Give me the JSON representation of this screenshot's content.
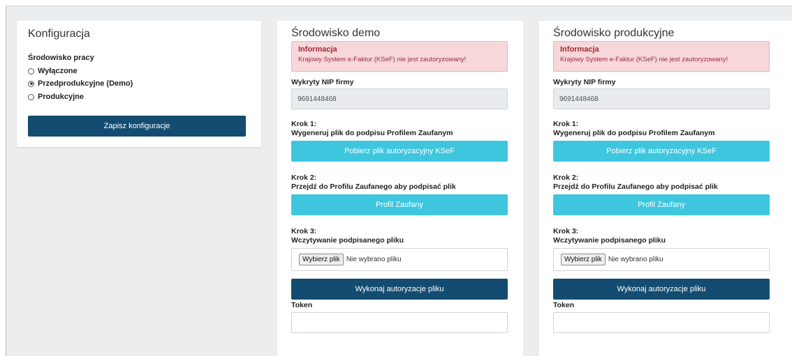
{
  "config": {
    "title": "Konfiguracja",
    "env_label": "Środowisko pracy",
    "options": [
      {
        "label": "Wyłączone",
        "checked": false
      },
      {
        "label": "Przedprodukcyjne (Demo)",
        "checked": true
      },
      {
        "label": "Produkcyjne",
        "checked": false
      }
    ],
    "save_label": "Zapisz konfiguracje"
  },
  "demo": {
    "title": "Środowisko demo",
    "alert_title": "Informacja",
    "alert_text": "Krajowy System e-Faktur (KSeF) nie jest zautoryzowany!",
    "nip_label": "Wykryty NIP firmy",
    "nip_value": "9691448468",
    "step1_title": "Krok 1:",
    "step1_desc": "Wygeneruj plik do podpisu Profilem Zaufanym",
    "step1_button": "Pobierz plik autoryzacyjny KSeF",
    "step2_title": "Krok 2:",
    "step2_desc": "Przejdź do Profilu Zaufanego aby podpisać plik",
    "step2_button": "Profil Zaufany",
    "step3_title": "Krok 3:",
    "step3_desc": "Wczytywanie podpisanego pliku",
    "file_button": "Wybierz plik",
    "file_status": "Nie wybrano pliku",
    "auth_button": "Wykonaj autoryzacje pliku",
    "token_label": "Token"
  },
  "prod": {
    "title": "Środowisko produkcyjne",
    "alert_title": "Informacja",
    "alert_text": "Krajowy System e-Faktur (KSeF) nie jest zautoryzowany!",
    "nip_label": "Wykryty NIP firmy",
    "nip_value": "9691448468",
    "step1_title": "Krok 1:",
    "step1_desc": "Wygeneruj plik do podpisu Profilem Zaufanym",
    "step1_button": "Pobierz plik autoryzacyjny KSeF",
    "step2_title": "Krok 2:",
    "step2_desc": "Przejdź do Profilu Zaufanego aby podpisać plik",
    "step2_button": "Profil Zaufany",
    "step3_title": "Krok 3:",
    "step3_desc": "Wczytywanie podpisanego pliku",
    "file_button": "Wybierz plik",
    "file_status": "Nie wybrano pliku",
    "auth_button": "Wykonaj autoryzacje pliku",
    "token_label": "Token"
  },
  "colors": {
    "primary": "#134c70",
    "info": "#3ec6de",
    "alert_bg": "#f8d7da",
    "alert_text": "#9b2b36"
  }
}
